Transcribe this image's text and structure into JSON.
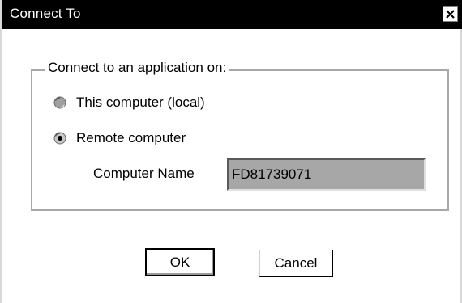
{
  "window": {
    "title": "Connect To",
    "close_label": "×"
  },
  "group": {
    "legend": "Connect to an application on:"
  },
  "options": [
    {
      "label": "This computer (local)",
      "selected": false
    },
    {
      "label": "Remote computer",
      "selected": true
    }
  ],
  "computer_name": {
    "label": "Computer Name",
    "value": "FD81739071"
  },
  "buttons": {
    "ok_label": "OK",
    "cancel_label": "Cancel"
  }
}
